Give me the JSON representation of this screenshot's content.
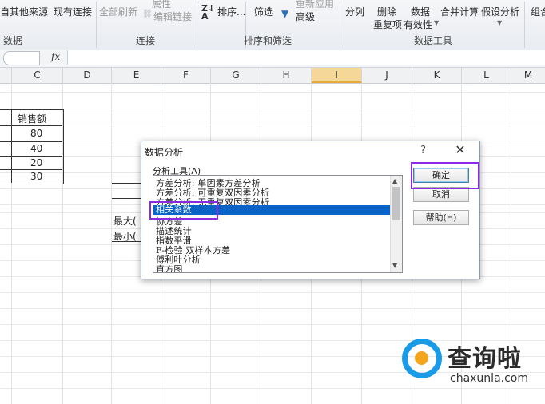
{
  "ribbon": {
    "get_external": {
      "other_sources": "自其他来源",
      "existing_conn": "现有连接",
      "group_label": "数据"
    },
    "connections": {
      "refresh_all": "全部刷新",
      "properties": "属性",
      "edit_links": "编辑链接",
      "group_label": "连接"
    },
    "sort_filter": {
      "sort": "排序...",
      "filter": "筛选",
      "reapply": "重新应用",
      "advanced": "高级",
      "group_label": "排序和筛选"
    },
    "data_tools": {
      "split": "分列",
      "remove_dup": "删除",
      "remove_dup2": "重复项",
      "validation": "数据",
      "validation2": "有效性",
      "consolidate": "合并计算",
      "whatif": "假设分析",
      "group_label": "数据工具"
    },
    "outline": {
      "group": "组合"
    }
  },
  "formula_bar": {
    "fx": "fx",
    "value": ""
  },
  "columns": [
    "C",
    "D",
    "E",
    "F",
    "G",
    "H",
    "I",
    "J",
    "K",
    "L",
    "M"
  ],
  "selected_column": "I",
  "sheet": {
    "header": "销售额",
    "values": [
      "80",
      "40",
      "20",
      "30"
    ],
    "max_label": "最大(",
    "min_label": "最小("
  },
  "dialog": {
    "title": "数据分析",
    "help_glyph": "?",
    "close_glyph": "✕",
    "list_label": "分析工具(A)",
    "items": [
      "方差分析: 单因素方差分析",
      "方差分析: 可重复双因素分析",
      "方差分析: 无重复双因素分析",
      "相关系数",
      "协方差",
      "描述统计",
      "指数平滑",
      "F-检验 双样本方差",
      "傅利叶分析",
      "直方图"
    ],
    "selected_index": 3,
    "buttons": {
      "ok": "确定",
      "cancel": "取消",
      "help": "帮助(H)"
    }
  },
  "watermark": {
    "brand": "查询啦",
    "url": "chaxunla.com"
  },
  "colors": {
    "highlight": "#8a2be2",
    "selection": "#0a64c8",
    "column_selected": "#f6d79a"
  }
}
